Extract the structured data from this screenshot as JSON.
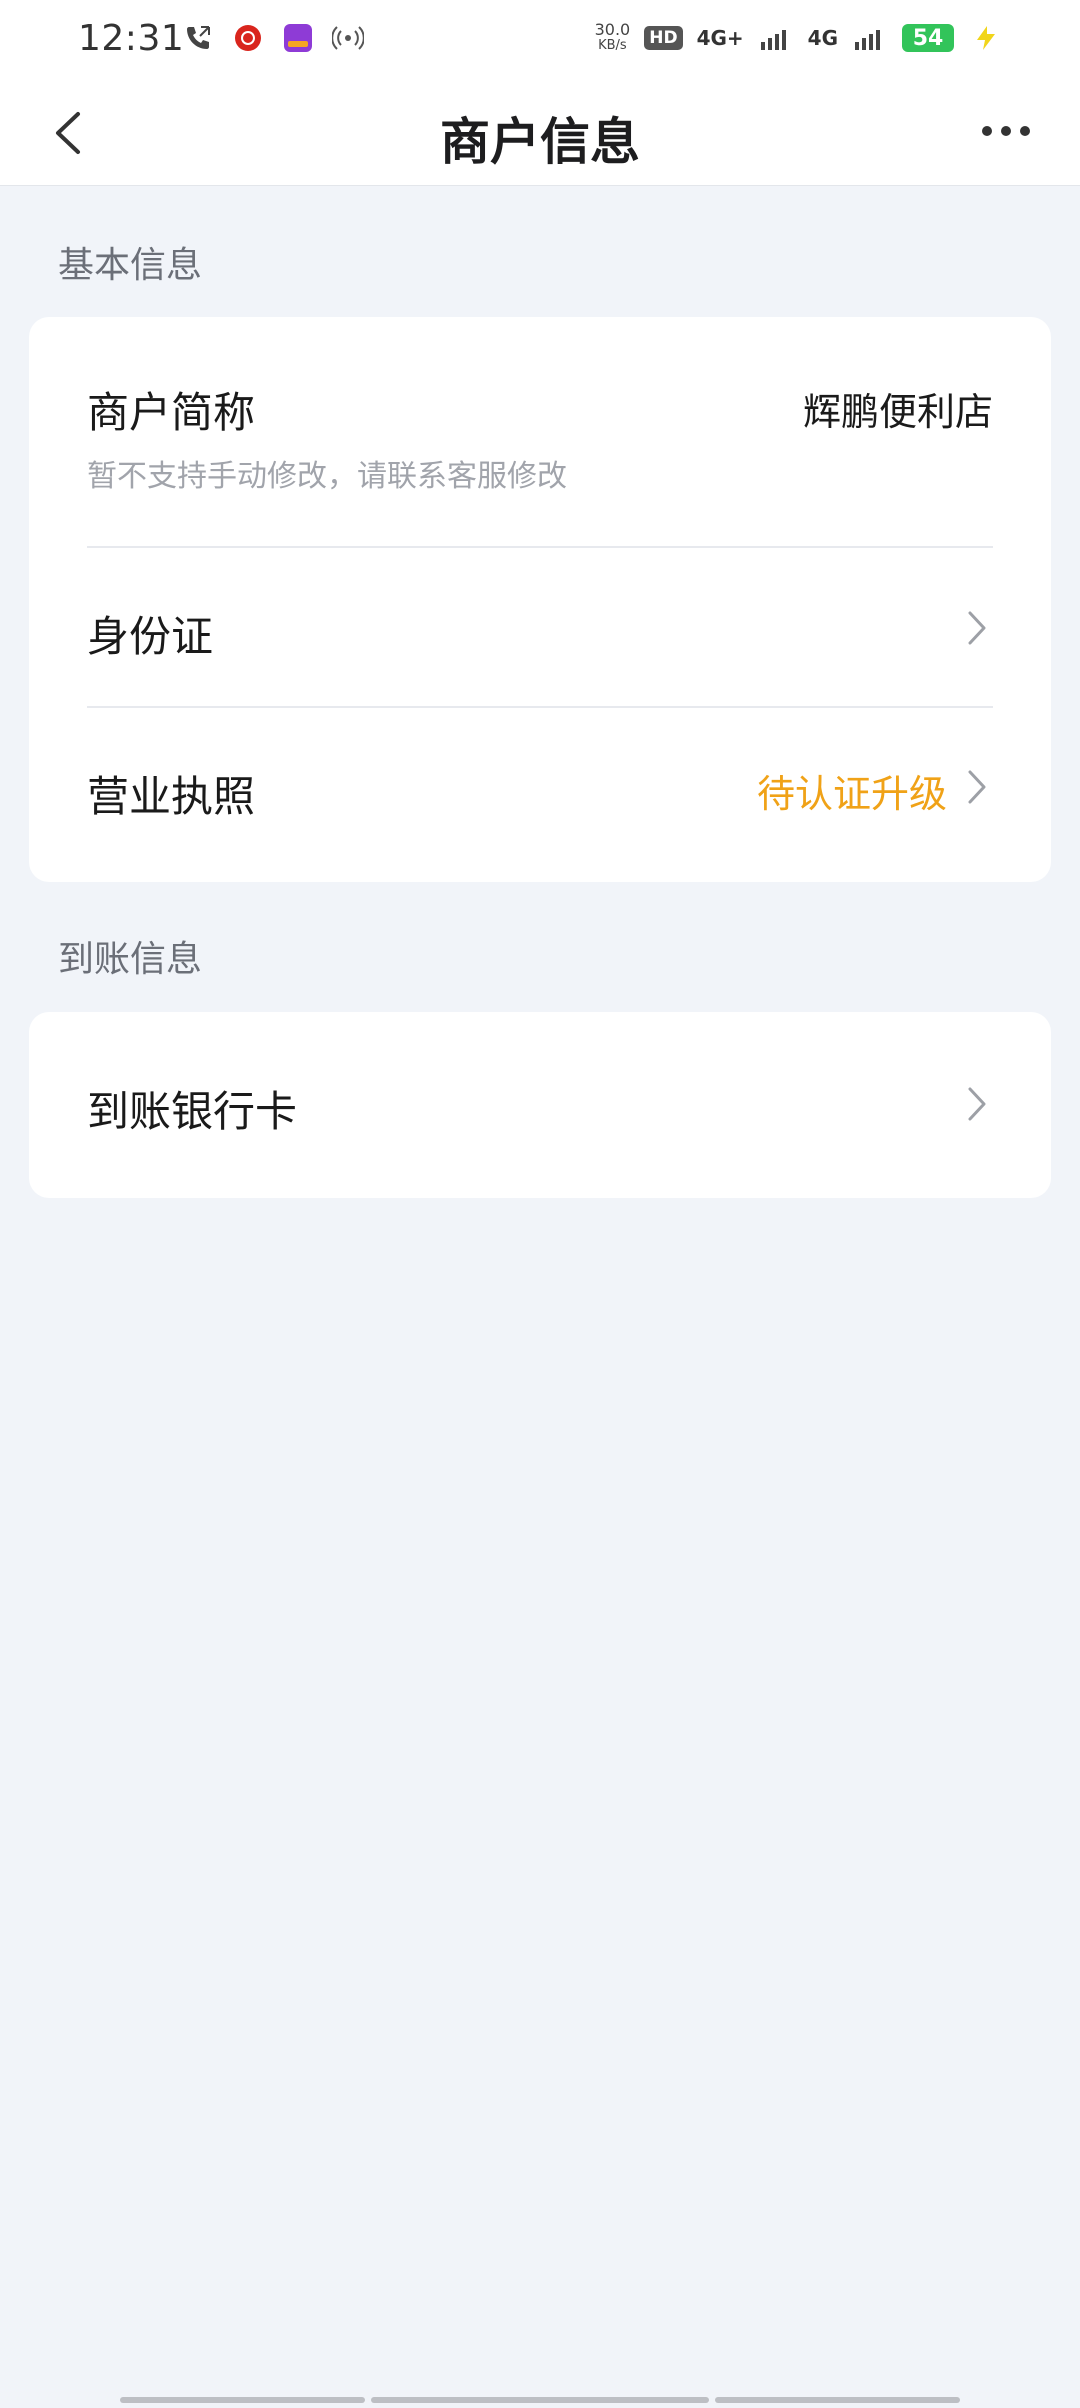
{
  "status_bar": {
    "time": "12:31",
    "net_speed_value": "30.0",
    "net_speed_unit": "KB/s",
    "hd_badge": "HD",
    "sim1_network": "4G+",
    "sim2_network": "4G",
    "battery": "54",
    "icons": [
      "missed-call-icon",
      "app-notification-icon",
      "bank-app-icon",
      "hotspot-icon",
      "signal-icon",
      "charging-icon"
    ]
  },
  "header": {
    "title": "商户信息"
  },
  "sections": {
    "basic": {
      "label": "基本信息",
      "merchant_name": {
        "label": "商户简称",
        "value": "辉鹏便利店",
        "hint": "暂不支持手动修改，请联系客服修改"
      },
      "id_card": {
        "label": "身份证"
      },
      "business_license": {
        "label": "营业执照",
        "status": "待认证升级"
      }
    },
    "settlement": {
      "label": "到账信息",
      "bank_card": {
        "label": "到账银行卡"
      }
    }
  },
  "colors": {
    "background": "#f1f4f9",
    "card": "#ffffff",
    "status_accent": "#f0a217",
    "battery": "#32c45a"
  }
}
